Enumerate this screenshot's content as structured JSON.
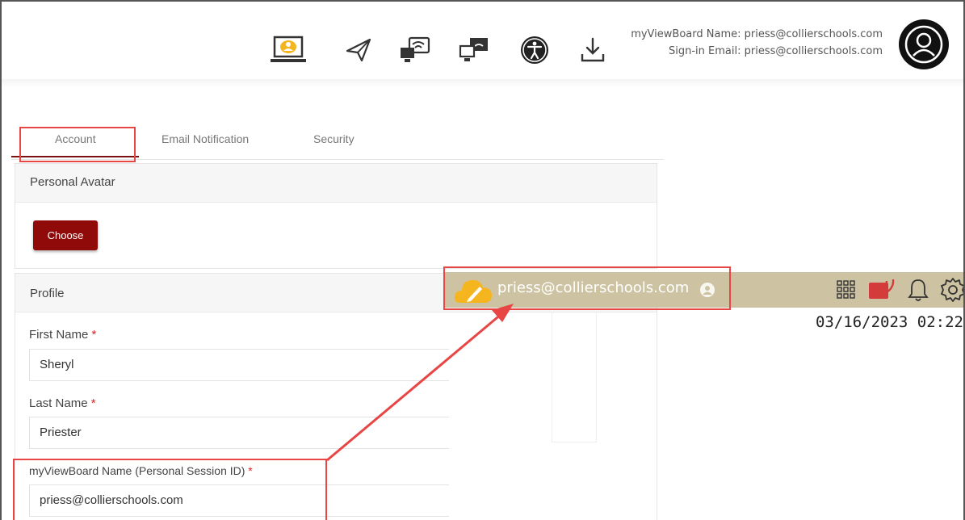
{
  "header": {
    "toolbar_icons": [
      "myviewboard-computer-icon",
      "send-icon",
      "cast-icon",
      "display-cast-icon",
      "accessibility-icon",
      "download-icon"
    ],
    "viewboard_name_line": "myViewBoard Name: priess@collierschools.com",
    "signin_email_line": "Sign-in Email: priess@collierschools.com",
    "avatar_icon": "user-avatar-icon"
  },
  "tabs": [
    {
      "label": "Account",
      "active": true
    },
    {
      "label": "Email Notification",
      "active": false
    },
    {
      "label": "Security",
      "active": false
    }
  ],
  "avatar_section": {
    "title": "Personal Avatar",
    "choose_label": "Choose"
  },
  "profile": {
    "title": "Profile",
    "required_mark": "*",
    "first_name": {
      "label": "First Name",
      "value": "Sheryl"
    },
    "last_name": {
      "label": "Last Name",
      "value": "Priester"
    },
    "session_id": {
      "label": "myViewBoard Name (Personal Session ID)",
      "value": "priess@collierschools.com"
    }
  },
  "overlay": {
    "user": "priess@collierschools.com",
    "datetime": "03/16/2023 02:22",
    "icons": [
      "pencil-cloud-icon",
      "user-circle-icon",
      "apps-grid-icon",
      "cast-signal-icon",
      "bell-icon",
      "gear-icon"
    ]
  },
  "colors": {
    "accent": "#900a0a",
    "highlight": "#e84545",
    "overlay_bar": "#cdc3a2",
    "cloud": "#f5b51e"
  }
}
